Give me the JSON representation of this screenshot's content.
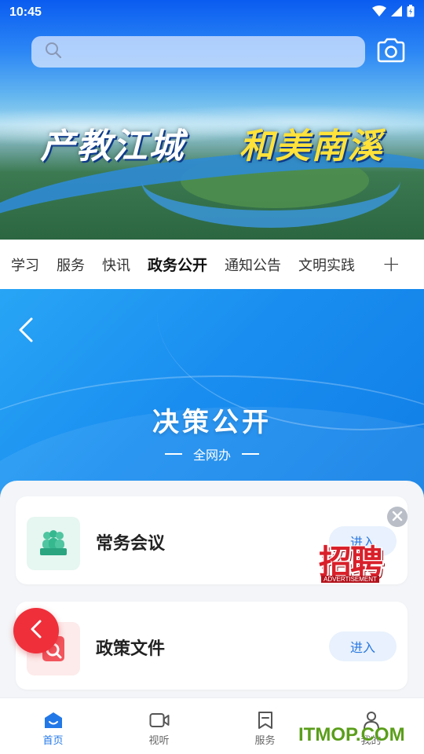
{
  "status_bar": {
    "time": "10:45"
  },
  "banner": {
    "slogan_part1": "产教江城",
    "slogan_part2": "和美南溪"
  },
  "tabs": {
    "items": [
      {
        "label": "学习"
      },
      {
        "label": "服务"
      },
      {
        "label": "快讯"
      },
      {
        "label": "政务公开",
        "active": true
      },
      {
        "label": "通知公告"
      },
      {
        "label": "文明实践"
      }
    ],
    "add_label": "+"
  },
  "hero": {
    "title": "决策公开",
    "subtitle": "全网办"
  },
  "cards": [
    {
      "label": "常务会议",
      "button": "进入",
      "icon": "meeting-people-icon",
      "icon_bg": "#e6f6f1"
    },
    {
      "label": "政策文件",
      "button": "进入",
      "icon": "document-search-icon",
      "icon_bg": "#fdeaea"
    }
  ],
  "ad_badge": {
    "big": "招聘",
    "small": "ADVERTISEMENT"
  },
  "bottom_nav": {
    "items": [
      {
        "label": "首页",
        "icon": "home-icon",
        "active": true
      },
      {
        "label": "视听",
        "icon": "video-icon"
      },
      {
        "label": "服务",
        "icon": "bookmark-icon"
      },
      {
        "label": "我的",
        "icon": "user-icon"
      }
    ]
  },
  "watermark": "ITMOP.COM",
  "colors": {
    "accent": "#2378e8",
    "hero_blue": "#1a8ef0",
    "float_button": "#ef2f3a"
  }
}
